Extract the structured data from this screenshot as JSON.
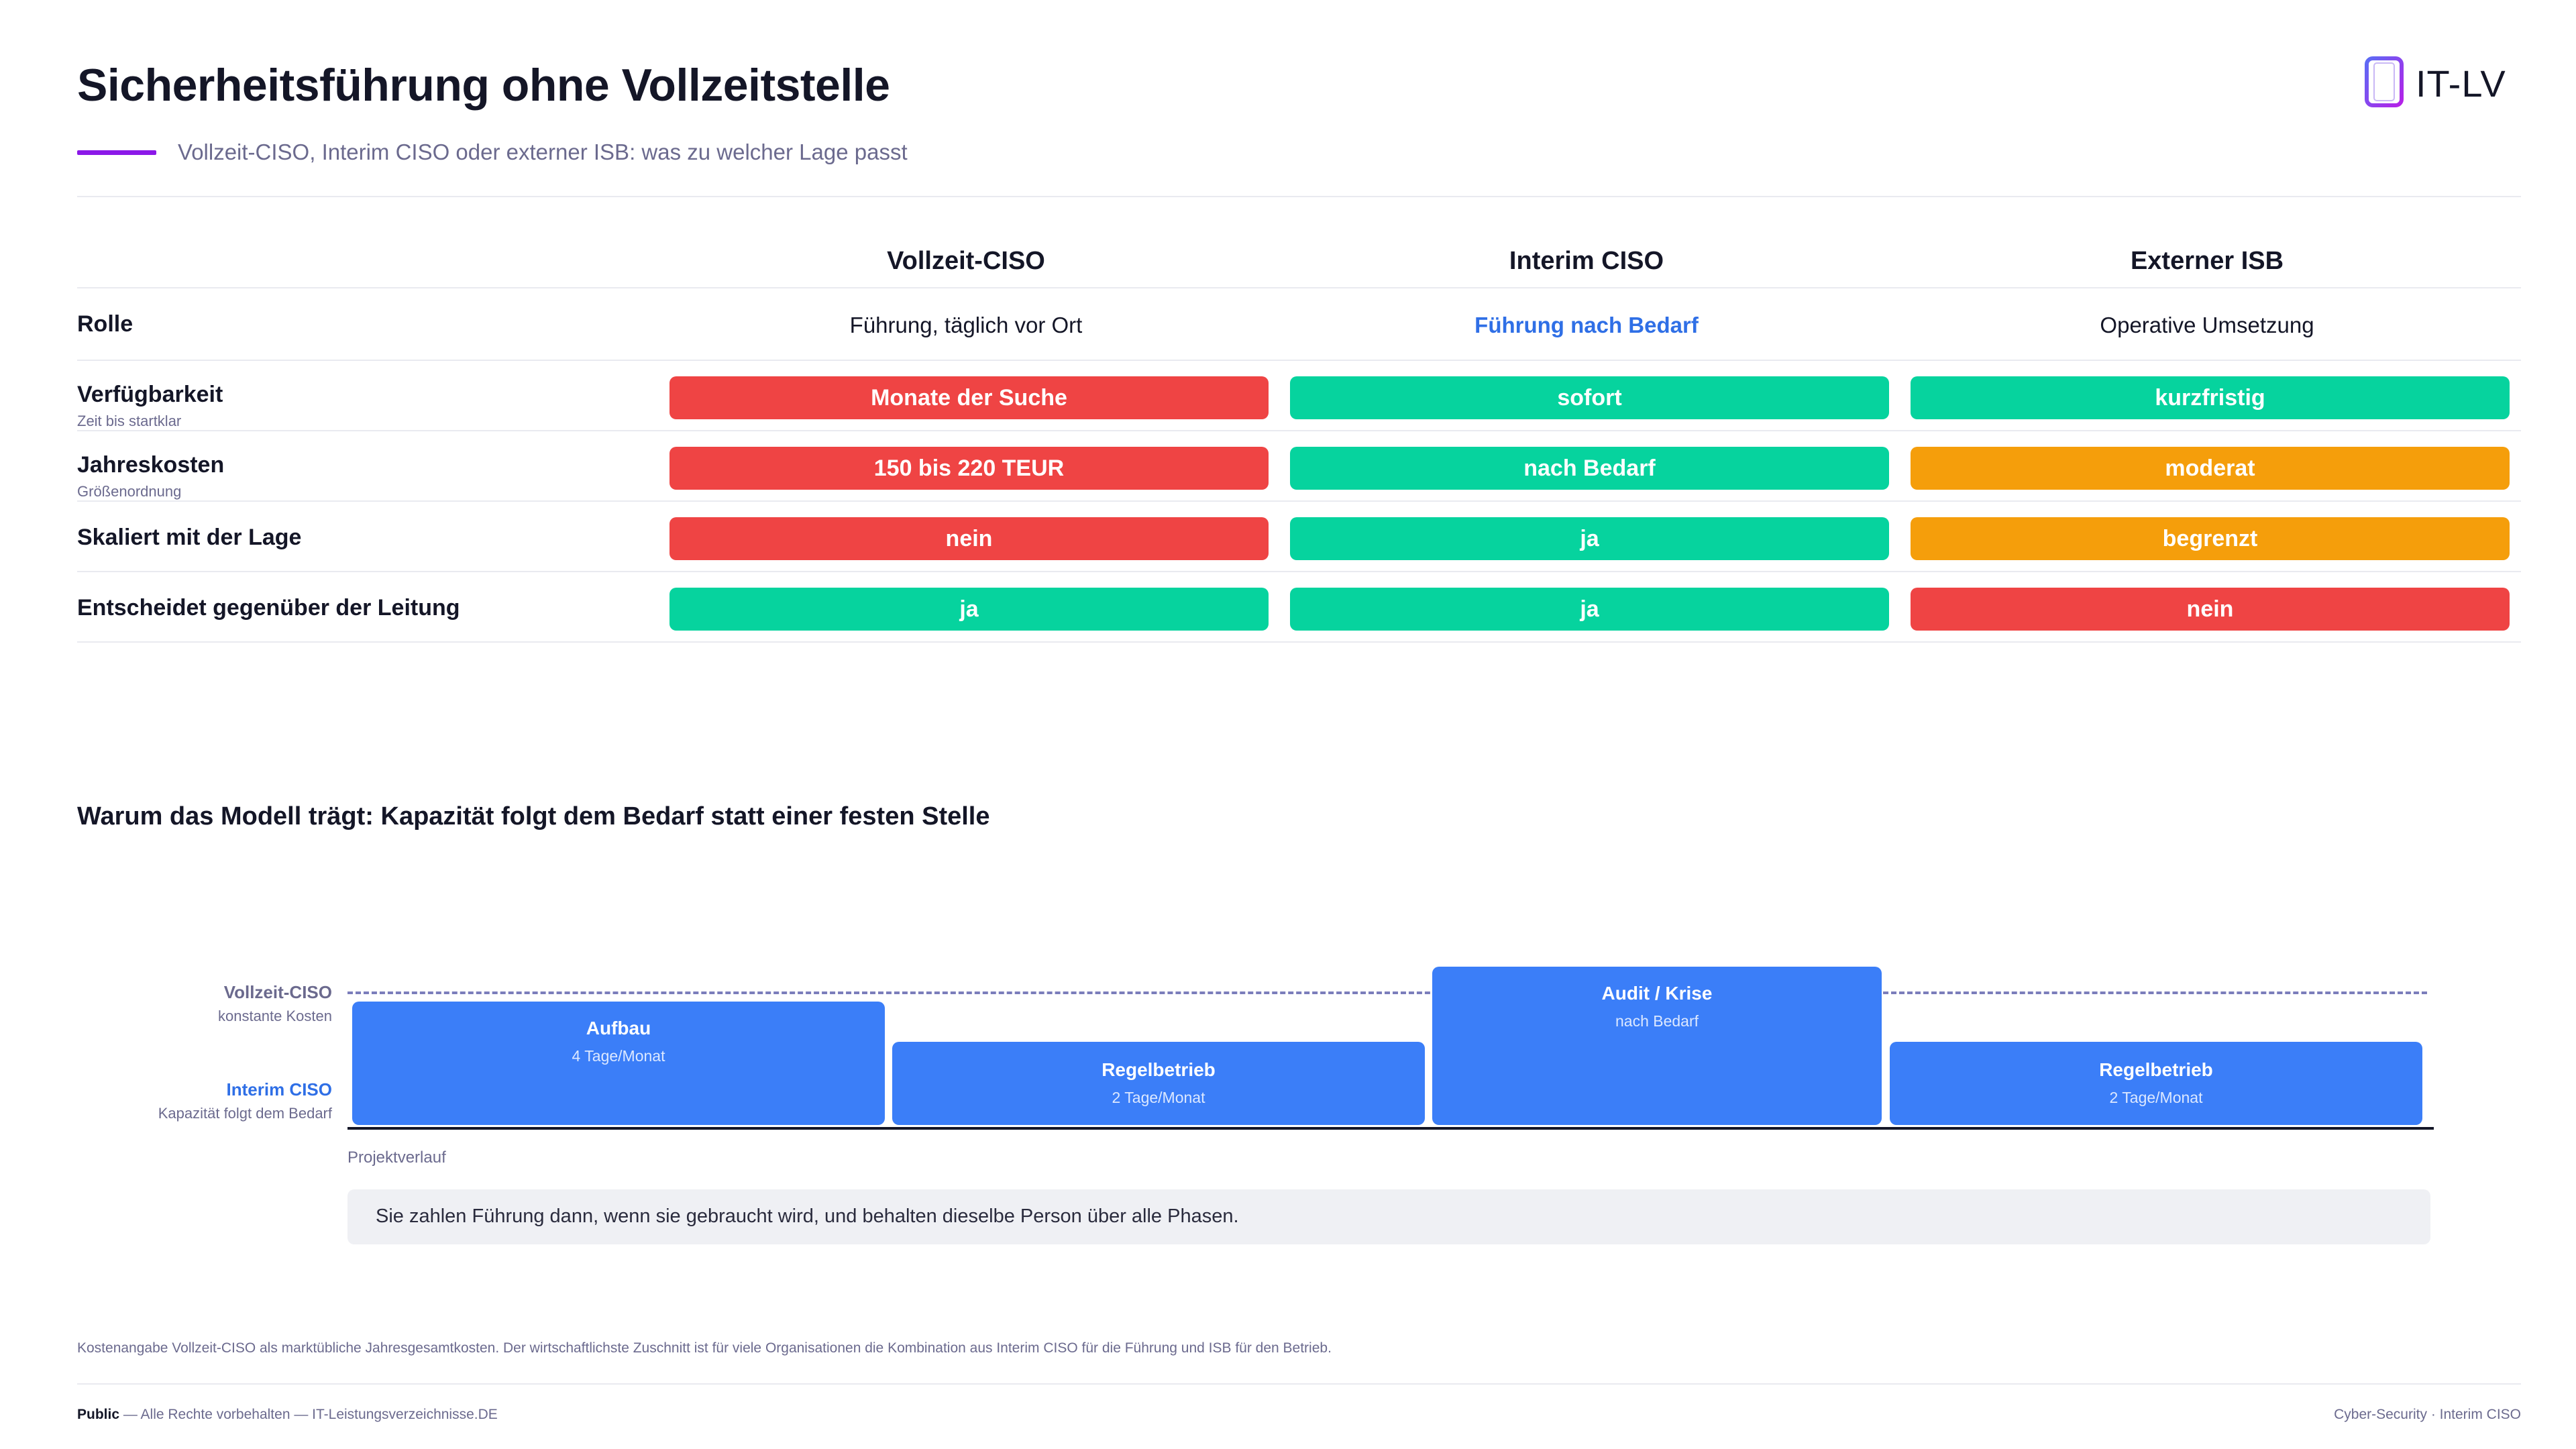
{
  "header": {
    "title": "Sicherheitsführung ohne Vollzeitstelle",
    "subtitle": "Vollzeit-CISO, Interim CISO oder externer ISB: was zu welcher Lage passt",
    "logo_text": "IT-LV",
    "accent_color": "#8b18e8"
  },
  "comparison": {
    "columns": [
      "Vollzeit-CISO",
      "Interim CISO",
      "Externer ISB"
    ],
    "role": {
      "label": "Rolle",
      "values": [
        "Führung, täglich vor Ort",
        "Führung nach Bedarf",
        "Operative Umsetzung"
      ]
    },
    "rows": [
      {
        "label": "Verfügbarkeit",
        "sub": "Zeit bis startklar",
        "values": [
          "Monate der Suche",
          "sofort",
          "kurzfristig"
        ],
        "status": [
          "red",
          "green",
          "green"
        ]
      },
      {
        "label": "Jahreskosten",
        "sub": "Größenordnung",
        "values": [
          "150 bis 220 TEUR",
          "nach Bedarf",
          "moderat"
        ],
        "status": [
          "red",
          "green",
          "orange"
        ]
      },
      {
        "label": "Skaliert mit der Lage",
        "sub": "",
        "values": [
          "nein",
          "ja",
          "begrenzt"
        ],
        "status": [
          "red",
          "green",
          "orange"
        ]
      },
      {
        "label": "Entscheidet gegenüber der Leitung",
        "sub": "",
        "values": [
          "ja",
          "ja",
          "nein"
        ],
        "status": [
          "green",
          "green",
          "red"
        ]
      }
    ],
    "status_colors": {
      "red": "#ef4444",
      "green": "#06d39e",
      "orange": "#f59e0b"
    }
  },
  "capacity": {
    "title": "Warum das Modell trägt: Kapazität folgt dem Bedarf statt einer festen Stelle",
    "fulltime_label": "Vollzeit-CISO",
    "fulltime_sub": "konstante Kosten",
    "interim_label": "Interim CISO",
    "interim_sub": "Kapazität folgt dem Bedarf",
    "x_label": "Projektverlauf",
    "phases": [
      {
        "name": "Aufbau",
        "detail": "4 Tage/Monat"
      },
      {
        "name": "Regelbetrieb",
        "detail": "2 Tage/Monat"
      },
      {
        "name": "Audit / Krise",
        "detail": "nach Bedarf"
      },
      {
        "name": "Regelbetrieb",
        "detail": "2 Tage/Monat"
      }
    ],
    "callout": "Sie zahlen Führung dann, wenn sie gebraucht wird, und behalten dieselbe Person über alle Phasen.",
    "bar_color": "#3b7ef8",
    "interim_color": "#2f6fe6"
  },
  "footer": {
    "footnote": "Kostenangabe Vollzeit-CISO als marktübliche Jahresgesamtkosten. Der wirtschaftlichste Zuschnitt ist für viele Organisationen die Kombination aus Interim CISO für die Führung und ISB für den Betrieb.",
    "classification": "Public",
    "rights": " — Alle Rechte vorbehalten — IT-Leistungsverzeichnisse.DE",
    "category": "Cyber-Security · Interim CISO"
  }
}
